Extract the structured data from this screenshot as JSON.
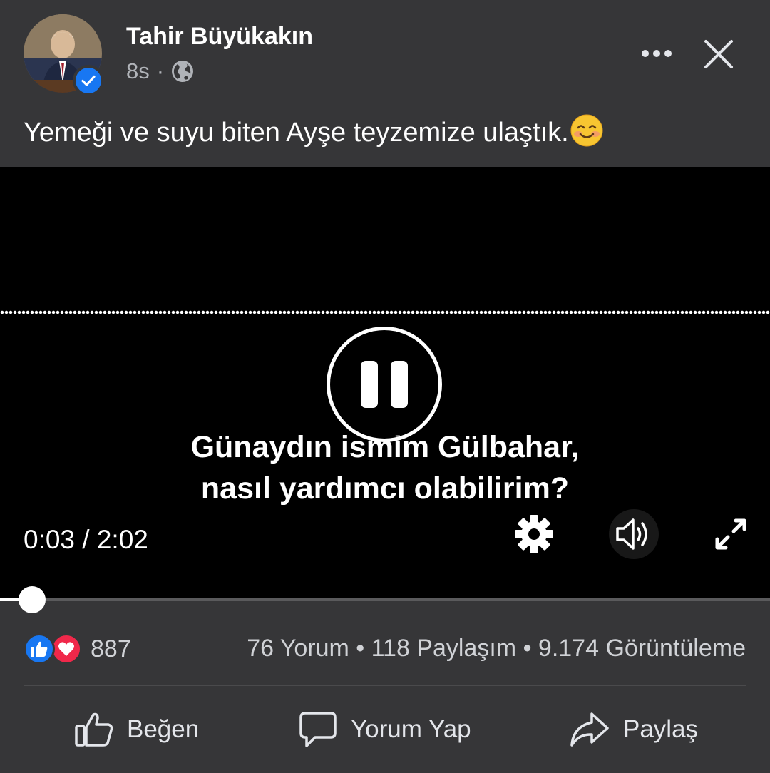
{
  "post": {
    "author": "Tahir Büyükakın",
    "time": "8s",
    "separator": "·",
    "caption": "Yemeği ve suyu biten Ayşe teyzemize ulaştık."
  },
  "video": {
    "subtitle_line1": "Günaydın ismim Gülbahar,",
    "subtitle_line2": "nasıl yardımcı olabilirim?",
    "timecode": "0:03 / 2:02",
    "progress": 0.025
  },
  "engagement": {
    "reaction_count": "887",
    "stats": "76 Yorum • 118 Paylaşım • 9.174 Görüntüleme"
  },
  "actions": {
    "like": "Beğen",
    "comment": "Yorum Yap",
    "share": "Paylaş"
  },
  "colors": {
    "background": "#363638",
    "like_blue": "#1877f2",
    "love_red": "#f0284a"
  }
}
